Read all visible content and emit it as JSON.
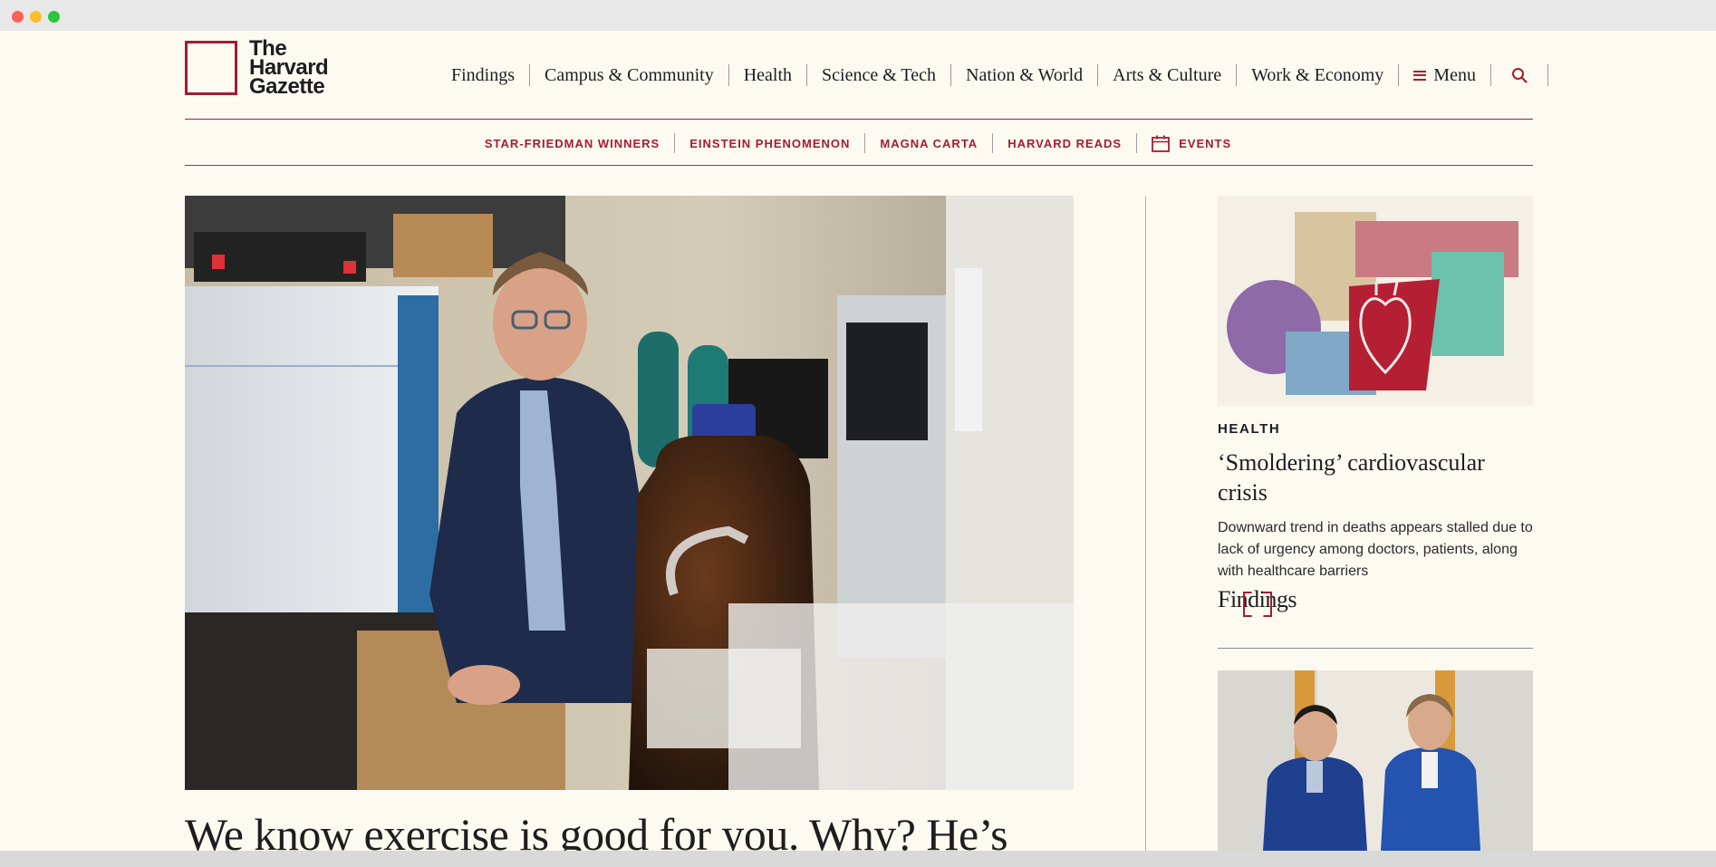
{
  "brand": {
    "logo_lines": [
      "The",
      "Harvard",
      "Gazette"
    ],
    "accent_color": "#a51c30"
  },
  "nav": {
    "items": [
      "Findings",
      "Campus & Community",
      "Health",
      "Science & Tech",
      "Nation & World",
      "Arts & Culture",
      "Work & Economy"
    ],
    "menu_label": "Menu",
    "menu_icon": "hamburger-icon",
    "search_icon": "search-icon"
  },
  "subnav": {
    "items": [
      "STAR-FRIEDMAN WINNERS",
      "EINSTEIN PHENOMENON",
      "MAGNA CARTA",
      "HARVARD READS"
    ],
    "events_label": "EVENTS",
    "events_icon": "calendar-icon"
  },
  "hero": {
    "image": "photo of a researcher seated in a laboratory",
    "headline": "We know exercise is good for you. Why? He’s"
  },
  "sidebar": {
    "story1": {
      "image": "collage illustration of hearts and medical imagery",
      "kicker": "HEALTH",
      "title": "‘Smoldering’ cardiovascular crisis",
      "description": "Downward trend in deaths appears stalled due to lack of urgency among doctors, patients, along with healthcare barriers",
      "tag": "Findings"
    },
    "story2": {
      "image": "photo of two men in blue blazers with arms crossed"
    }
  }
}
